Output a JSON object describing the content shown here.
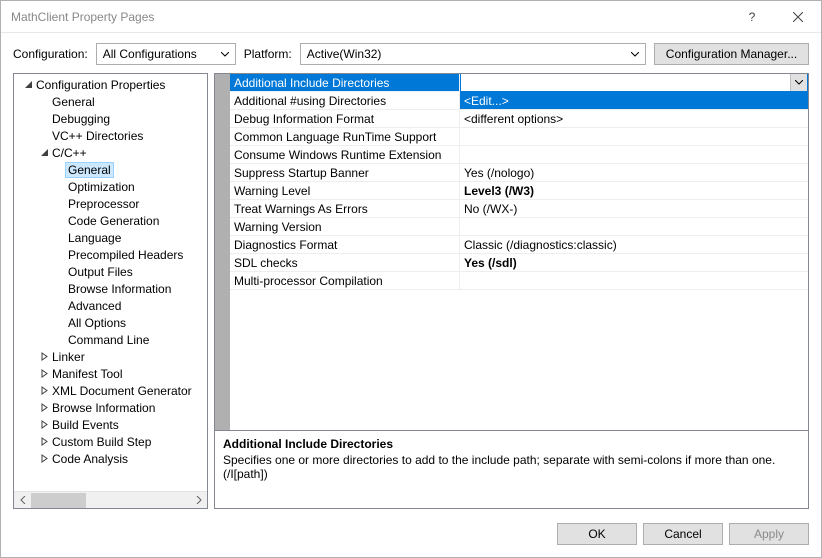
{
  "window": {
    "title": "MathClient Property Pages"
  },
  "toolbar": {
    "configuration_label": "Configuration:",
    "configuration_value": "All Configurations",
    "platform_label": "Platform:",
    "platform_value": "Active(Win32)",
    "config_manager_label": "Configuration Manager..."
  },
  "tree": [
    {
      "depth": 0,
      "exp": "open",
      "label": "Configuration Properties"
    },
    {
      "depth": 1,
      "exp": "none",
      "label": "General"
    },
    {
      "depth": 1,
      "exp": "none",
      "label": "Debugging"
    },
    {
      "depth": 1,
      "exp": "none",
      "label": "VC++ Directories"
    },
    {
      "depth": 1,
      "exp": "open",
      "label": "C/C++"
    },
    {
      "depth": 2,
      "exp": "none",
      "label": "General",
      "selected": true
    },
    {
      "depth": 2,
      "exp": "none",
      "label": "Optimization"
    },
    {
      "depth": 2,
      "exp": "none",
      "label": "Preprocessor"
    },
    {
      "depth": 2,
      "exp": "none",
      "label": "Code Generation"
    },
    {
      "depth": 2,
      "exp": "none",
      "label": "Language"
    },
    {
      "depth": 2,
      "exp": "none",
      "label": "Precompiled Headers"
    },
    {
      "depth": 2,
      "exp": "none",
      "label": "Output Files"
    },
    {
      "depth": 2,
      "exp": "none",
      "label": "Browse Information"
    },
    {
      "depth": 2,
      "exp": "none",
      "label": "Advanced"
    },
    {
      "depth": 2,
      "exp": "none",
      "label": "All Options"
    },
    {
      "depth": 2,
      "exp": "none",
      "label": "Command Line"
    },
    {
      "depth": 1,
      "exp": "closed",
      "label": "Linker"
    },
    {
      "depth": 1,
      "exp": "closed",
      "label": "Manifest Tool"
    },
    {
      "depth": 1,
      "exp": "closed",
      "label": "XML Document Generator"
    },
    {
      "depth": 1,
      "exp": "closed",
      "label": "Browse Information"
    },
    {
      "depth": 1,
      "exp": "closed",
      "label": "Build Events"
    },
    {
      "depth": 1,
      "exp": "closed",
      "label": "Custom Build Step"
    },
    {
      "depth": 1,
      "exp": "closed",
      "label": "Code Analysis"
    }
  ],
  "grid": [
    {
      "key": "Additional Include Directories",
      "value": "",
      "mode": "header"
    },
    {
      "key": "Additional #using Directories",
      "value": "<Edit...>",
      "mode": "edit"
    },
    {
      "key": "Debug Information Format",
      "value": "<different options>"
    },
    {
      "key": "Common Language RunTime Support",
      "value": ""
    },
    {
      "key": "Consume Windows Runtime Extension",
      "value": ""
    },
    {
      "key": "Suppress Startup Banner",
      "value": "Yes (/nologo)"
    },
    {
      "key": "Warning Level",
      "value": "Level3 (/W3)",
      "bold": true
    },
    {
      "key": "Treat Warnings As Errors",
      "value": "No (/WX-)"
    },
    {
      "key": "Warning Version",
      "value": ""
    },
    {
      "key": "Diagnostics Format",
      "value": "Classic (/diagnostics:classic)"
    },
    {
      "key": "SDL checks",
      "value": "Yes (/sdl)",
      "bold": true
    },
    {
      "key": "Multi-processor Compilation",
      "value": ""
    }
  ],
  "description": {
    "title": "Additional Include Directories",
    "text": "Specifies one or more directories to add to the include path; separate with semi-colons if more than one. (/I[path])"
  },
  "footer": {
    "ok": "OK",
    "cancel": "Cancel",
    "apply": "Apply"
  }
}
